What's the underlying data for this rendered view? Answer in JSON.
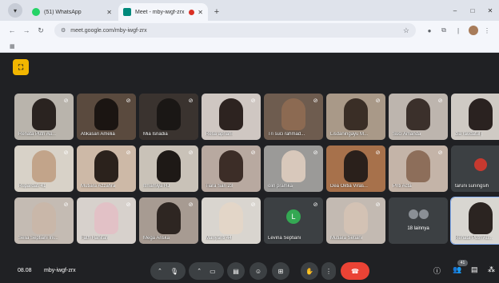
{
  "tabs": [
    {
      "title": "(51) WhatsApp",
      "favicon_color": "#25d366",
      "active": false
    },
    {
      "title": "Meet - mby-iwgf-zrx",
      "favicon_color": "#00897b",
      "active": true
    }
  ],
  "window_controls": {
    "minimize": "–",
    "maximize": "□",
    "close": "✕"
  },
  "toolbar": {
    "url": "meet.google.com/mby-iwgf-zrx"
  },
  "meeting": {
    "time": "08.08",
    "code": "mby-iwgf-zrx",
    "participant_count": "41"
  },
  "participants": [
    {
      "name": "Renata Putri Au...",
      "bg": "#b9b4ac",
      "face": "#2a2320"
    },
    {
      "name": "Atikasari Amelia",
      "bg": "#5a4a3e",
      "face": "#1b1512"
    },
    {
      "name": "Mia Isnadia",
      "bg": "#3a332f",
      "face": "#1a1715"
    },
    {
      "name": "Resa apriani",
      "bg": "#cfc7c2",
      "face": "#2d2320"
    },
    {
      "name": "Tri suci rahmad...",
      "bg": "#6e5c4f",
      "face": "#8c6a52"
    },
    {
      "name": "Lisdaningayu M...",
      "bg": "#a99988",
      "face": "#3a2e26"
    },
    {
      "name": "Suci Amanda",
      "bg": "#bdb5ae",
      "face": "#3b302b"
    },
    {
      "name": "dia raudatul j",
      "bg": "#cfcac4",
      "face": "#2a2220"
    },
    {
      "name": "Rupardati 41",
      "bg": "#d8d2c8",
      "face": "#c2a48a"
    },
    {
      "name": "Mutiara Azzahra",
      "bg": "#cdb9a7",
      "face": "#2b221c"
    },
    {
      "name": "Itmamiya HJ",
      "bg": "#c9c2b8",
      "face": "#1e1916"
    },
    {
      "name": "Tiara Sari 23",
      "bg": "#b8a9a0",
      "face": "#3c2d27"
    },
    {
      "name": "olin pramka",
      "bg": "#9b9a98",
      "face": "#d8c8bb"
    },
    {
      "name": "Dea Oktia Viras...",
      "bg": "#a7714b",
      "face": "#2a201b"
    },
    {
      "name": "Priti Acta",
      "bg": "#c4b4a8",
      "face": "#8d6e5a"
    },
    {
      "name": "taruni suningsih",
      "bg": "#3c4043",
      "face": "#c6392f",
      "avatar": true
    },
    {
      "name": "Selia Septiani Ini...",
      "bg": "#c4bbb3",
      "face": "#c9b7a9"
    },
    {
      "name": "Fath Hanifah",
      "bg": "#d7d1cc",
      "face": "#e2c1c6"
    },
    {
      "name": "Mega Ariska",
      "bg": "#a79b92",
      "face": "#2e2622"
    },
    {
      "name": "Mariyanti 44",
      "bg": "#d9d5cf",
      "face": "#e3d6c8"
    },
    {
      "name": "Levina Septiani",
      "bg": "#3c4043",
      "face": "#34a853",
      "letter": "L"
    },
    {
      "name": "Mutiara Setiani",
      "bg": "#c3bab2",
      "face": "#d3c2b4"
    },
    {
      "name": "18 lainnya",
      "bg": "#3c4043",
      "face": "#8a8f95",
      "more": true
    },
    {
      "name": "Renata Putri Au...",
      "bg": "#d8d6d1",
      "face": "#2b2421",
      "pinned": true
    }
  ],
  "icons": {
    "mic_off": "mic-off-icon",
    "chevron_up": "chevron-up-icon",
    "camera": "camera-icon",
    "captions": "captions-icon",
    "emoji": "emoji-icon",
    "present": "present-icon",
    "raise_hand": "hand-icon",
    "more": "more-vert-icon",
    "hangup": "hangup-icon",
    "info": "info-icon",
    "people": "people-icon",
    "chat": "chat-icon",
    "activities": "activities-icon"
  }
}
